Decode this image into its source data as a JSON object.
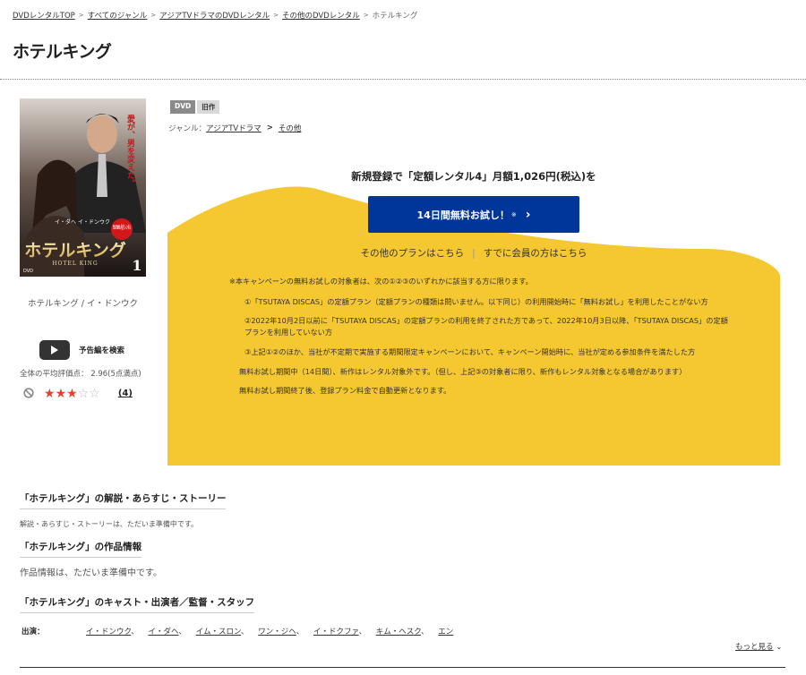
{
  "breadcrumb": {
    "items": [
      "DVDレンタルTOP",
      "すべてのジャンル",
      "アジアTVドラマのDVDレンタル",
      "その他のDVDレンタル"
    ],
    "current": "ホテルキング",
    "separator": ">"
  },
  "title": "ホテルキング",
  "jacket": {
    "tagline": "愛が、男を変えた。",
    "cast_names": "イ・ダヘ イ・ドンウク",
    "badge": "TSUTAYA 先行 レンタル",
    "logo_title": "ホテルキング",
    "logo_sub": "HOTEL KING",
    "volume": "1",
    "format": "DVD"
  },
  "jacket_subtitle": "ホテルキング / イ・ドンウク",
  "trailer_label": "予告編を検索",
  "rating": {
    "average_label": "全体の平均評価点：",
    "average_value": "2.96(5点満点)",
    "stars_filled": 3,
    "stars_total": 5,
    "count": "(4)"
  },
  "badges": {
    "format": "DVD",
    "status": "旧作"
  },
  "genre": {
    "label": "ジャンル：",
    "items": [
      "アジアTVドラマ",
      "その他"
    ],
    "separator": ">"
  },
  "promo": {
    "headline": "新規登録で「定額レンタル4」月額1,026円(税込)を",
    "button_label": "14日間無料お試し！",
    "button_note": "※",
    "other_plans": "その他のプランはこちら",
    "members": "すでに会員の方はこちら",
    "terms": [
      "※本キャンペーンの無料お試しの対象者は、次の①②③のいずれかに該当する方に限ります。",
      "①「TSUTAYA DISCAS」の定額プラン（定額プランの種類は問いません。以下同じ）の利用開始時に「無料お試し」を利用したことがない方",
      "②2022年10月2日以前に「TSUTAYA DISCAS」の定額プランの利用を終了された方であって、2022年10月3日以降、「TSUTAYA DISCAS」の定額プランを利用していない方",
      "③上記①②のほか、当社が不定期で実施する期間限定キャンペーンにおいて、キャンペーン開始時に、当社が定める参加条件を満たした方",
      "無料お試し期間中（14日間）、新作はレンタル対象外です。（但し、上記③の対象者に限り、新作もレンタル対象となる場合があります）",
      "無料お試し期間終了後、登録プラン料金で自動更新となります。"
    ],
    "colors": {
      "yellow": "#f5c731",
      "button": "#00369a"
    }
  },
  "sections": {
    "story_head": "「ホテルキング」の解説・あらすじ・ストーリー",
    "story_text": "解説・あらすじ・ストーリーは、ただいま準備中です。",
    "info_head": "「ホテルキング」の作品情報",
    "info_text": "作品情報は、ただいま準備中です。",
    "cast_head": "「ホテルキング」のキャスト・出演者／監督・スタッフ"
  },
  "cast": {
    "label": "出演：",
    "names": [
      "イ・ドンウク",
      "イ・ダヘ",
      "イム・スロン",
      "ワン・ジヘ",
      "イ・ドクファ",
      "キム・ヘスク",
      "エン"
    ],
    "separator": "、"
  },
  "more_label": "もっと見る"
}
